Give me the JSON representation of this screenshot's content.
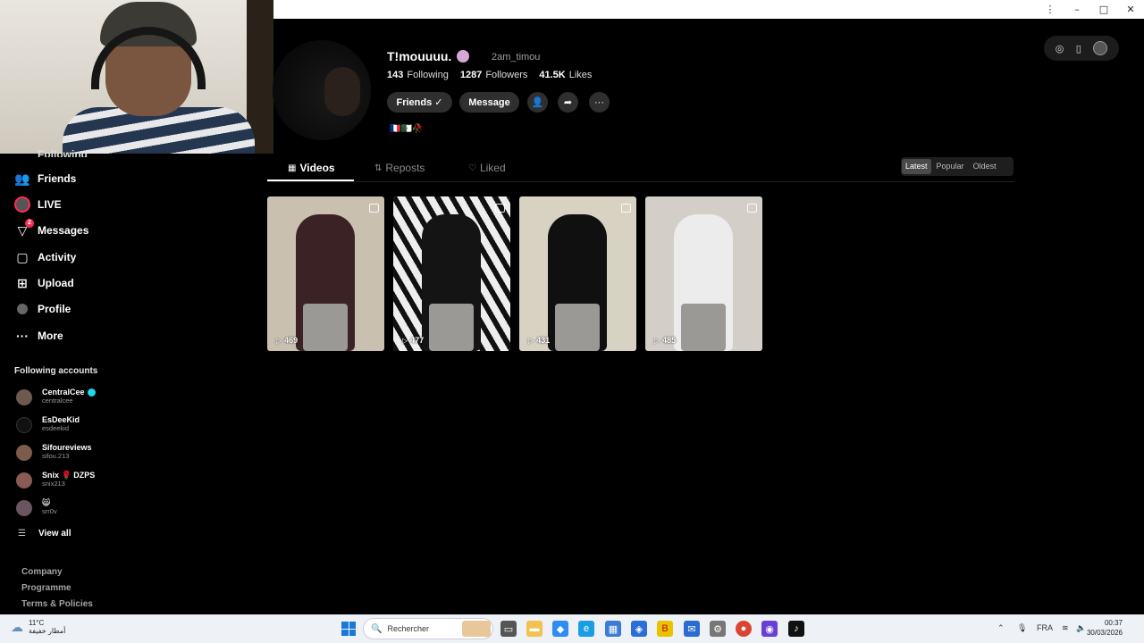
{
  "window": {
    "controls": [
      "⋮",
      "–",
      "□",
      "✕"
    ]
  },
  "sidebar": {
    "partial_item": "Following",
    "items": [
      {
        "label": "Friends",
        "icon": "friends-icon"
      },
      {
        "label": "LIVE",
        "icon": "live-icon"
      },
      {
        "label": "Messages",
        "icon": "messages-icon",
        "badge": "2"
      },
      {
        "label": "Activity",
        "icon": "activity-icon"
      },
      {
        "label": "Upload",
        "icon": "upload-icon"
      },
      {
        "label": "Profile",
        "icon": "profile-icon"
      },
      {
        "label": "More",
        "icon": "more-icon"
      }
    ],
    "following_title": "Following accounts",
    "accounts": [
      {
        "name": "CentralCee",
        "username": "centralcee",
        "verified": true
      },
      {
        "name": "EsDeeKid",
        "username": "esdeekid"
      },
      {
        "name": "Sifoureviews",
        "username": "sifou.213"
      },
      {
        "name": "Snix 🌹 DZPS",
        "username": "snix213"
      },
      {
        "name": "😸",
        "username": "srr0v"
      }
    ],
    "view_all": "View all",
    "footer": [
      "Company",
      "Programme",
      "Terms & Policies"
    ]
  },
  "profile": {
    "display_name": "T!mouuuu.",
    "username": "2am_timou",
    "following_count": "143",
    "following_label": "Following",
    "followers_count": "1287",
    "followers_label": "Followers",
    "likes_count": "41.5K",
    "likes_label": "Likes",
    "friends_button": "Friends ✓",
    "message_button": "Message",
    "bio": "🇫🇷🇩🇿🥀"
  },
  "tabs": [
    {
      "label": "Videos",
      "icon": "grid-icon",
      "active": true
    },
    {
      "label": "Reposts",
      "icon": "repost-icon"
    },
    {
      "label": "Liked",
      "icon": "heart-icon"
    }
  ],
  "sort": {
    "options": [
      "Latest",
      "Popular",
      "Oldest"
    ],
    "selected": "Latest"
  },
  "videos": [
    {
      "views": "469",
      "bg": "#c9c0b0",
      "outfit": "#3a2225"
    },
    {
      "views": "477",
      "bg": "#d9d6d1",
      "outfit": "#141414"
    },
    {
      "views": "431",
      "bg": "#d8d2c3",
      "outfit": "#101010"
    },
    {
      "views": "485",
      "bg": "#d3cfc8",
      "outfit": "#ececec"
    }
  ],
  "taskbar": {
    "temperature": "11°C",
    "weather_text": "أمطار خفيفة",
    "search_placeholder": "Rechercher",
    "language": "FRA",
    "time": "00:37",
    "date": "30/03/2026"
  },
  "colors": {
    "accent": "#fe2c55",
    "background": "#000000",
    "verified": "#20d5ec"
  }
}
